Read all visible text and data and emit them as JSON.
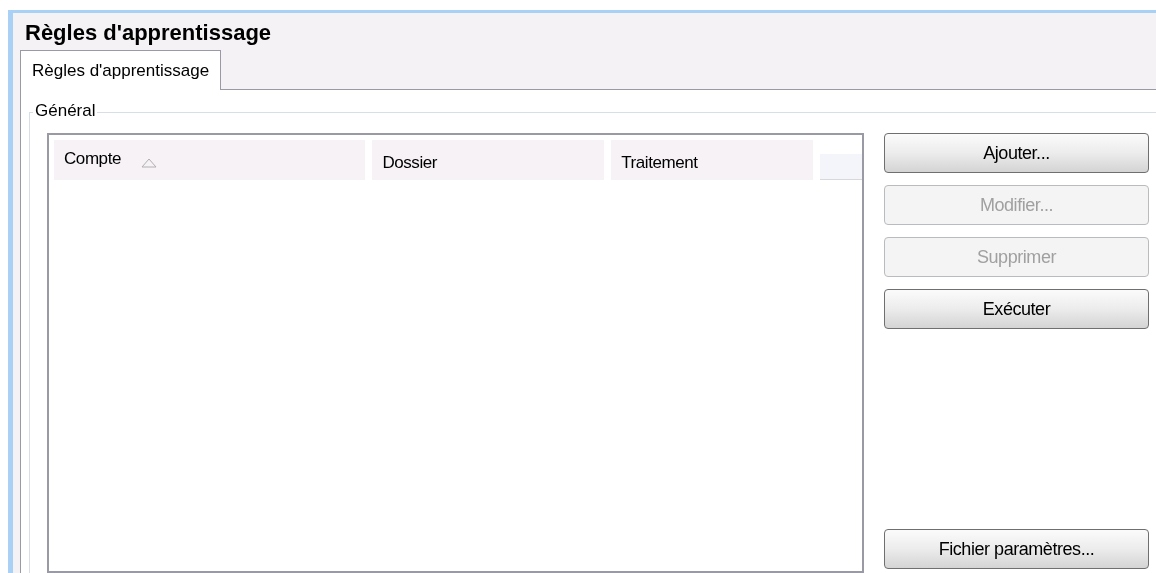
{
  "window": {
    "title": "Règles d'apprentissage"
  },
  "tabs": [
    {
      "label": "Règles d'apprentissage",
      "selected": true
    }
  ],
  "group": {
    "title": "Général"
  },
  "table": {
    "columns": [
      {
        "label": "Compte",
        "sorted": true
      },
      {
        "label": "Dossier",
        "sorted": false
      },
      {
        "label": "Traitement",
        "sorted": false
      }
    ]
  },
  "buttons": [
    {
      "label": "Ajouter...",
      "disabled": false
    },
    {
      "label": "Modifier...",
      "disabled": true
    },
    {
      "label": "Supprimer",
      "disabled": true
    },
    {
      "label": "Exécuter",
      "disabled": false
    }
  ],
  "bottom_button": {
    "label": "Fichier paramètres...",
    "disabled": false
  }
}
